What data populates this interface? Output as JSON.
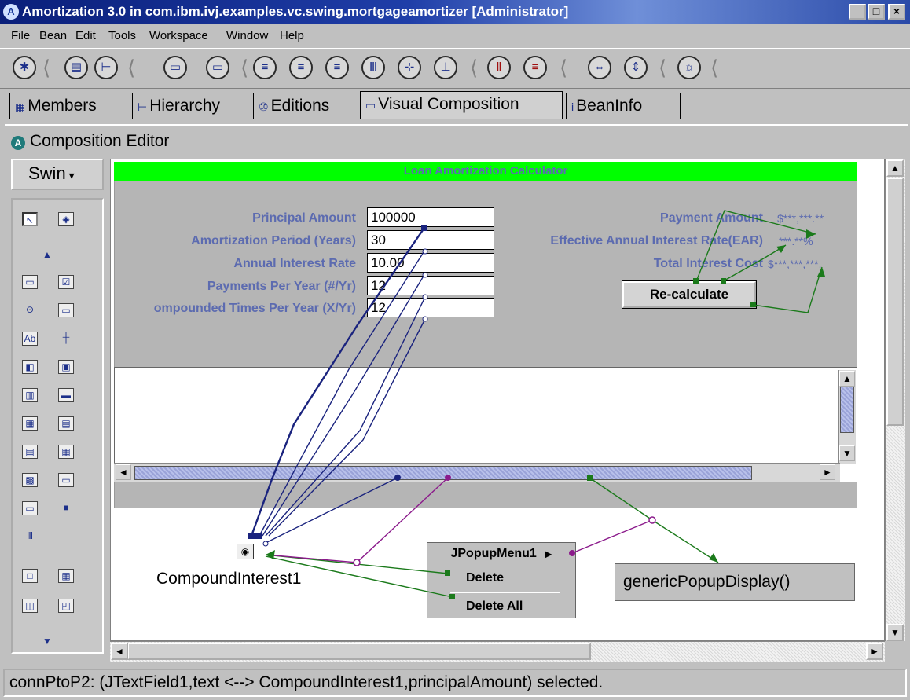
{
  "window": {
    "title": "Amortization 3.0 in com.ibm.ivj.examples.vc.swing.mortgageamortizer [Administrator]",
    "icon_letter": "A",
    "minimize": "_",
    "maximize": "□",
    "close": "×"
  },
  "menubar": [
    "File",
    "Bean",
    "Edit",
    "Tools",
    "Workspace",
    "Window",
    "Help"
  ],
  "toolbar": {
    "icons": [
      "run-icon",
      "beans-list-icon",
      "hierarchy-icon",
      "text-field-icon",
      "text-field-alt-icon",
      "align-left-icon",
      "align-center-icon",
      "align-right-icon",
      "align-top-icon",
      "align-middle-icon",
      "align-bottom-icon",
      "distribute-horizontal-icon",
      "distribute-vertical-icon",
      "match-width-icon",
      "match-height-icon",
      "properties-icon"
    ]
  },
  "tabs": [
    {
      "label": "Members",
      "active": false
    },
    {
      "label": "Hierarchy",
      "active": false
    },
    {
      "label": "Editions",
      "active": false
    },
    {
      "label": "Visual Composition",
      "active": true
    },
    {
      "label": "BeanInfo",
      "active": false
    }
  ],
  "composition_editor": {
    "icon_letter": "A",
    "title": "Composition Editor",
    "palette_category": "Swin",
    "palette_icons": [
      "selection-tool-icon",
      "choose-bean-icon",
      "scroll-up-icon",
      "text-field-icon",
      "checkbox-icon",
      "radio-button-icon",
      "toggle-button-icon",
      "label-icon",
      "slider-icon",
      "button-icon",
      "panel-icon",
      "list-icon",
      "combo-icon",
      "table-icon",
      "tree-icon",
      "split-pane-icon",
      "tabbed-pane-icon",
      "internal-frame-icon",
      "menu-icon",
      "progress-bar-icon",
      "toolbar-icon",
      "frame-icon",
      "dialog-icon",
      "window-icon",
      "applet-icon",
      "scroll-down-icon"
    ]
  },
  "loan_bean": {
    "header": "Loan Amortization Calculator",
    "inputs": [
      {
        "label": "Principal Amount",
        "value": "100000"
      },
      {
        "label": "Amortization Period (Years)",
        "value": "30"
      },
      {
        "label": "Annual Interest Rate",
        "value": "10.00"
      },
      {
        "label": "Payments Per Year (#/Yr)",
        "value": "12"
      },
      {
        "label": "ompounded Times Per Year (X/Yr)",
        "value": "12"
      }
    ],
    "outputs": [
      {
        "label": "Payment Amount",
        "value": "$***,***.**"
      },
      {
        "label": "Effective Annual Interest Rate(EAR)",
        "value": "***.**%"
      },
      {
        "label": "Total Interest Cost",
        "value": "$***,***,***."
      }
    ],
    "recalc_button": "Re-calculate"
  },
  "nonvisual_beans": {
    "compound_interest": "CompoundInterest1",
    "popup_menu": {
      "title": "JPopupMenu1",
      "items": [
        "Delete",
        "Delete All"
      ]
    },
    "script_method": "genericPopupDisplay()"
  },
  "scroll": {
    "up": "▲",
    "down": "▼",
    "left": "◄",
    "right": "►"
  },
  "statusbar": "connPtoP2: (JTextField1,text <--> CompoundInterest1,principalAmount) selected.",
  "colors": {
    "title_bar": "#0a1f7a",
    "bean_header": "#00ff00",
    "label_text": "#5c6bb0",
    "connection_property": "#1a237e",
    "connection_event_method": "#1b7a1b",
    "connection_event_script": "#8b1a8b"
  }
}
